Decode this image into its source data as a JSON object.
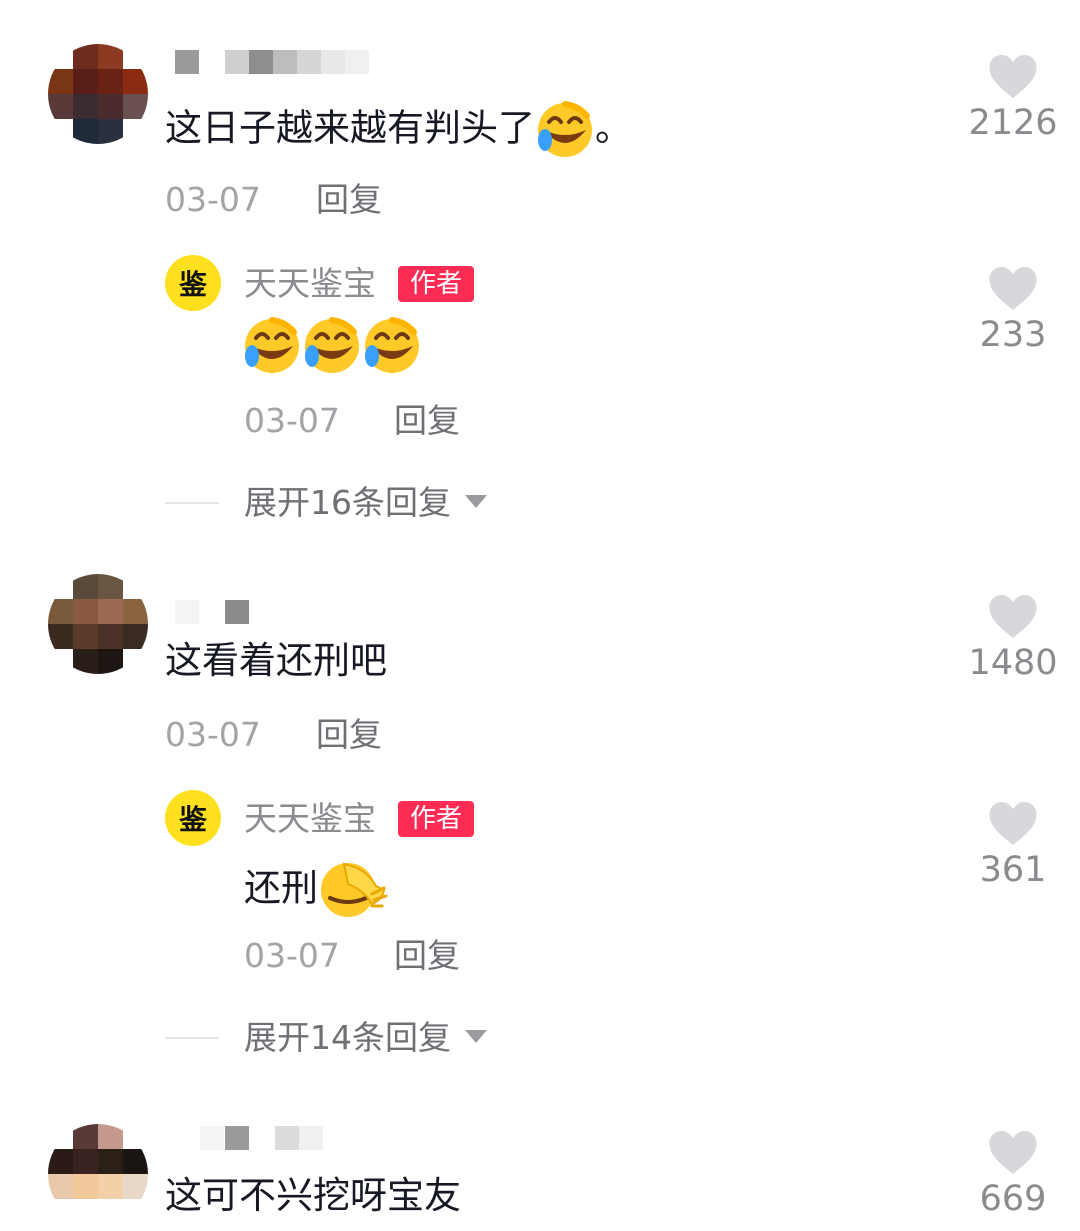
{
  "colors": {
    "author_badge": "#fe2c55",
    "author_avatar_bg": "#ffe01f",
    "heart": "#d8d8dc"
  },
  "author_avatar_char": "鉴",
  "comments": [
    {
      "text": "这日子越来越有判头了",
      "text_suffix": "。",
      "emoji": "laugh-cry",
      "date": "03-07",
      "reply_label": "回复",
      "likes": "2126",
      "author_reply": {
        "name": "天天鉴宝",
        "badge": "作者",
        "emoji": [
          "laugh-cry",
          "laugh-cry",
          "laugh-cry"
        ],
        "date": "03-07",
        "reply_label": "回复",
        "likes": "233"
      },
      "expand_label": "展开16条回复"
    },
    {
      "text": "这看着还刑吧",
      "date": "03-07",
      "reply_label": "回复",
      "likes": "1480",
      "author_reply": {
        "name": "天天鉴宝",
        "badge": "作者",
        "text": "还刑",
        "emoji": [
          "facepalm"
        ],
        "date": "03-07",
        "reply_label": "回复",
        "likes": "361"
      },
      "expand_label": "展开14条回复"
    },
    {
      "text": "这可不兴挖呀宝友",
      "likes": "669"
    }
  ]
}
